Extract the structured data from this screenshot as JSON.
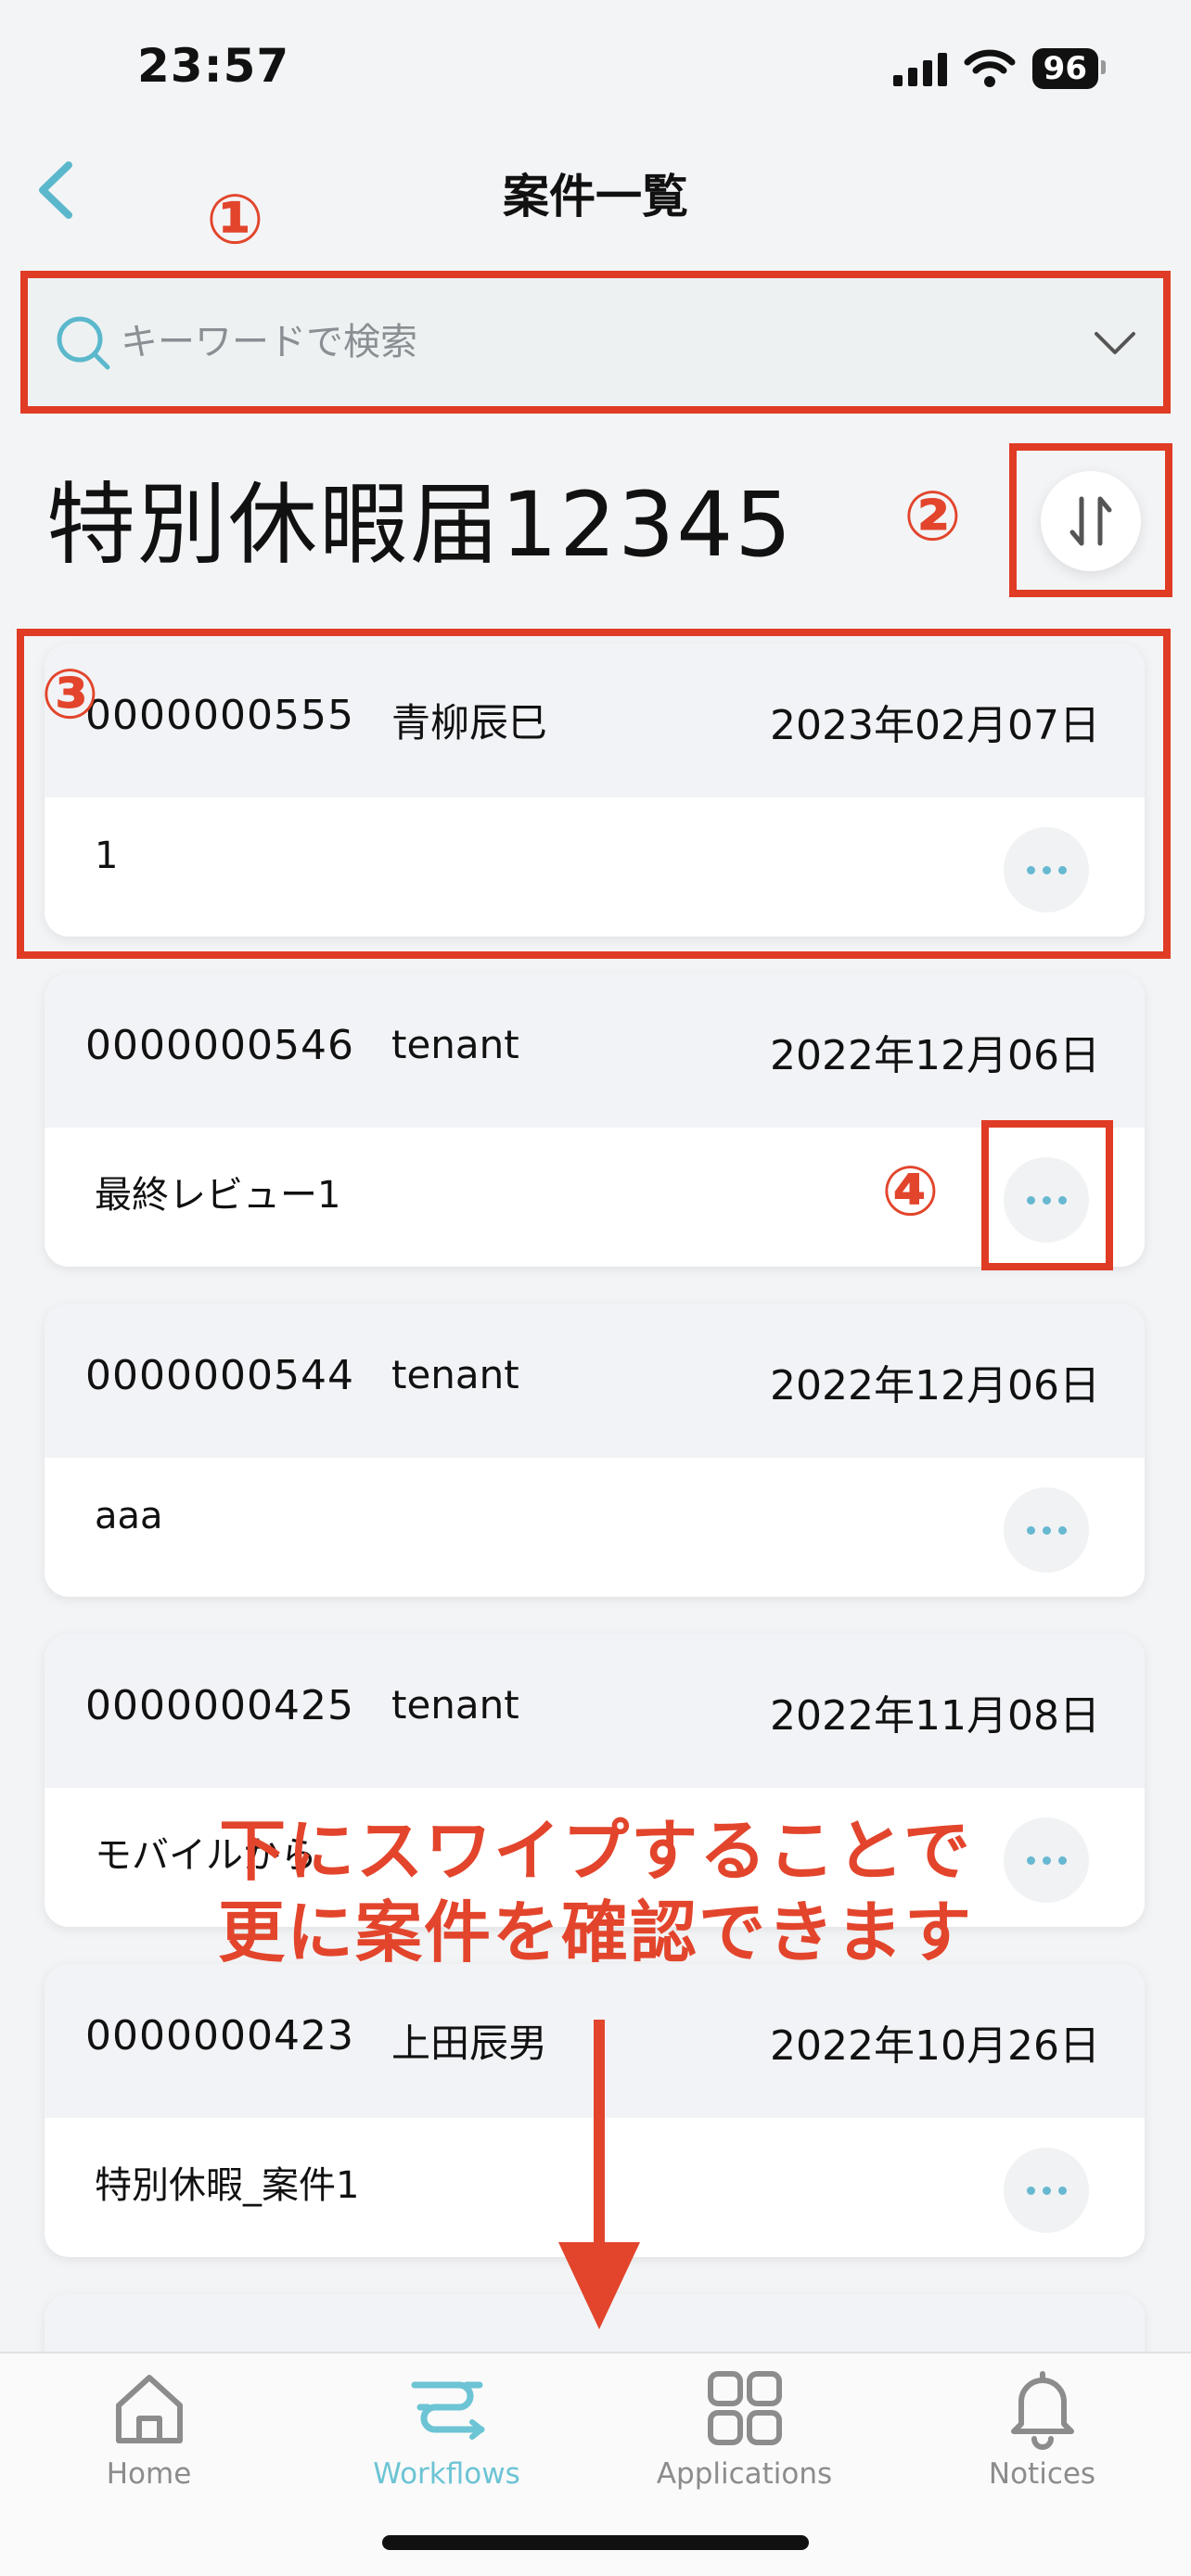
{
  "status_bar": {
    "time": "23:57",
    "battery": "96"
  },
  "header": {
    "title": "案件一覧"
  },
  "search": {
    "placeholder": "キーワードで検索",
    "value": ""
  },
  "section": {
    "title": "特別休暇届12345"
  },
  "annotations": {
    "n1": "①",
    "n2": "②",
    "n3": "③",
    "n4": "④"
  },
  "cases": [
    {
      "id": "0000000555",
      "user": "青柳辰巳",
      "date": "2023年02月07日",
      "text": "1"
    },
    {
      "id": "0000000546",
      "user": "tenant",
      "date": "2022年12月06日",
      "text": "最終レビュー1"
    },
    {
      "id": "0000000544",
      "user": "tenant",
      "date": "2022年12月06日",
      "text": "aaa"
    },
    {
      "id": "0000000425",
      "user": "tenant",
      "date": "2022年11月08日",
      "text": "モバイルから"
    },
    {
      "id": "0000000423",
      "user": "上田辰男",
      "date": "2022年10月26日",
      "text": "特別休暇_案件1"
    }
  ],
  "overlay": {
    "line1": "下にスワイプすることで",
    "line2": "更に案件を確認できます"
  },
  "tabs": [
    {
      "label": "Home",
      "icon": "home-icon",
      "active": false
    },
    {
      "label": "Workflows",
      "icon": "workflows-icon",
      "active": true
    },
    {
      "label": "Applications",
      "icon": "grid-icon",
      "active": false
    },
    {
      "label": "Notices",
      "icon": "bell-icon",
      "active": false
    }
  ],
  "colors": {
    "accent": "#6cc4d4",
    "annotation": "#e2452c",
    "back": "#5bb8cc"
  }
}
